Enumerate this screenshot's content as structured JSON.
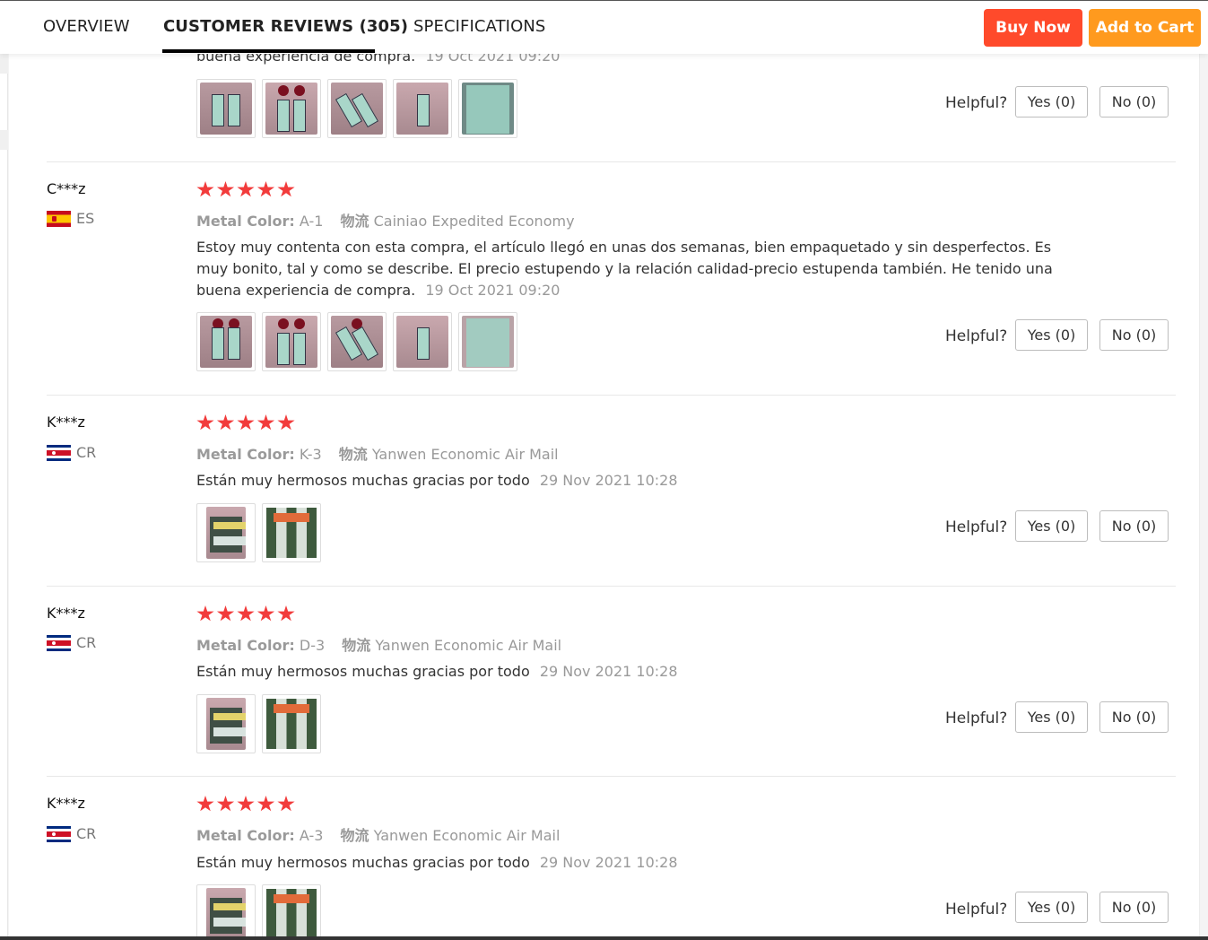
{
  "nav": {
    "tabs": [
      {
        "label": "OVERVIEW"
      },
      {
        "label": "CUSTOMER REVIEWS (305)"
      },
      {
        "label": "SPECIFICATIONS"
      }
    ],
    "buy_now": "Buy Now",
    "add_to_cart": "Add to Cart"
  },
  "colors": {
    "buy_now": "#ff4a2b",
    "add_to_cart": "#ff9a1e",
    "star": "#f23b3b"
  },
  "helpful_label": "Helpful?",
  "reviews": [
    {
      "partial_text": "buena experiencia de compra.",
      "date": "19 Oct 2021 09:20",
      "yes": "Yes (0)",
      "no": "No (0)"
    },
    {
      "user": "C***z",
      "country": "ES",
      "rating": 5,
      "color_label": "Metal Color:",
      "color_value": "A-1",
      "ship_label": "物流",
      "ship_value": "Cainiao Expedited Economy",
      "text": "Estoy muy contenta con esta compra, el artículo llegó en unas dos semanas, bien empaquetado y sin desperfectos. Es muy bonito, tal y como se describe. El precio estupendo y la relación calidad-precio estupenda también. He tenido una buena experiencia de compra.",
      "date": "19 Oct 2021 09:20",
      "yes": "Yes (0)",
      "no": "No (0)"
    },
    {
      "user": "K***z",
      "country": "CR",
      "rating": 5,
      "color_label": "Metal Color:",
      "color_value": "K-3",
      "ship_label": "物流",
      "ship_value": "Yanwen Economic Air Mail",
      "text": "Están muy hermosos muchas gracias por todo",
      "date": "29 Nov 2021 10:28",
      "yes": "Yes (0)",
      "no": "No (0)"
    },
    {
      "user": "K***z",
      "country": "CR",
      "rating": 5,
      "color_label": "Metal Color:",
      "color_value": "D-3",
      "ship_label": "物流",
      "ship_value": "Yanwen Economic Air Mail",
      "text": "Están muy hermosos muchas gracias por todo",
      "date": "29 Nov 2021 10:28",
      "yes": "Yes (0)",
      "no": "No (0)"
    },
    {
      "user": "K***z",
      "country": "CR",
      "rating": 5,
      "color_label": "Metal Color:",
      "color_value": "A-3",
      "ship_label": "物流",
      "ship_value": "Yanwen Economic Air Mail",
      "text": "Están muy hermosos muchas gracias por todo",
      "date": "29 Nov 2021 10:28",
      "yes": "Yes (0)",
      "no": "No (0)"
    }
  ]
}
